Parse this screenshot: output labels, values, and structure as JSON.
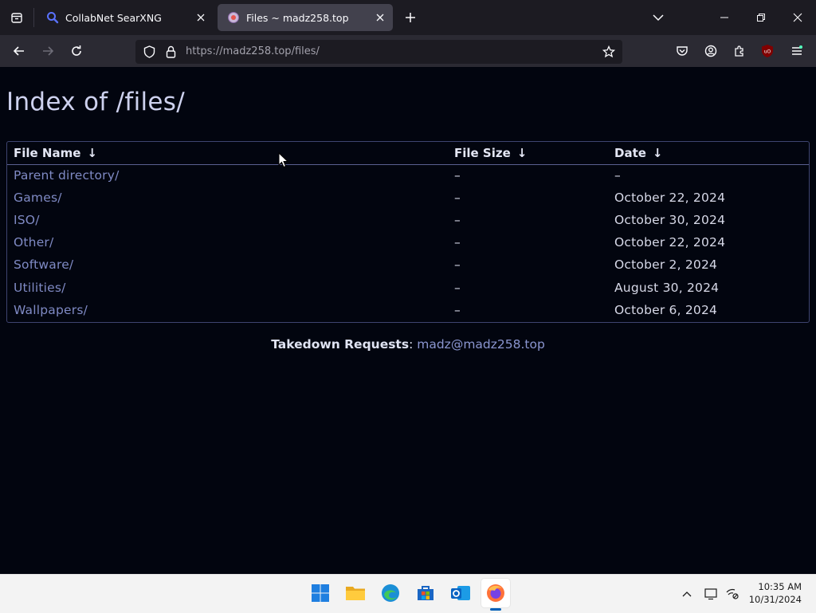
{
  "browser": {
    "tabs": [
      {
        "title": "CollabNet SearXNG",
        "active": false,
        "favicon": "search-favicon"
      },
      {
        "title": "Files ~ madz258.top",
        "active": true,
        "favicon": "site-favicon"
      }
    ],
    "url_host": "https://madz258.top",
    "url_path": "/files/"
  },
  "page": {
    "heading": "Index of /files/",
    "columns": {
      "name": "File Name",
      "size": "File Size",
      "date": "Date",
      "sort_arrow": "↓"
    },
    "rows": [
      {
        "name": "Parent directory/",
        "size": "–",
        "date": "–"
      },
      {
        "name": "Games/",
        "size": "–",
        "date": "October 22, 2024"
      },
      {
        "name": "ISO/",
        "size": "–",
        "date": "October 30, 2024"
      },
      {
        "name": "Other/",
        "size": "–",
        "date": "October 22, 2024"
      },
      {
        "name": "Software/",
        "size": "–",
        "date": "October 2, 2024"
      },
      {
        "name": "Utilities/",
        "size": "–",
        "date": "August 30, 2024"
      },
      {
        "name": "Wallpapers/",
        "size": "–",
        "date": "October 6, 2024"
      }
    ],
    "footer_label": "Takedown Requests",
    "footer_sep": ":",
    "footer_email": "madz@madz258.top"
  },
  "taskbar": {
    "apps": [
      "start",
      "file-explorer",
      "edge",
      "store",
      "outlook",
      "firefox"
    ],
    "time": "10:35 AM",
    "date": "10/31/2024"
  },
  "colors": {
    "page_bg": "#02050f",
    "link": "#7f8ac4",
    "tab_bar": "#1c1b22",
    "nav_bar": "#2b2a33"
  }
}
